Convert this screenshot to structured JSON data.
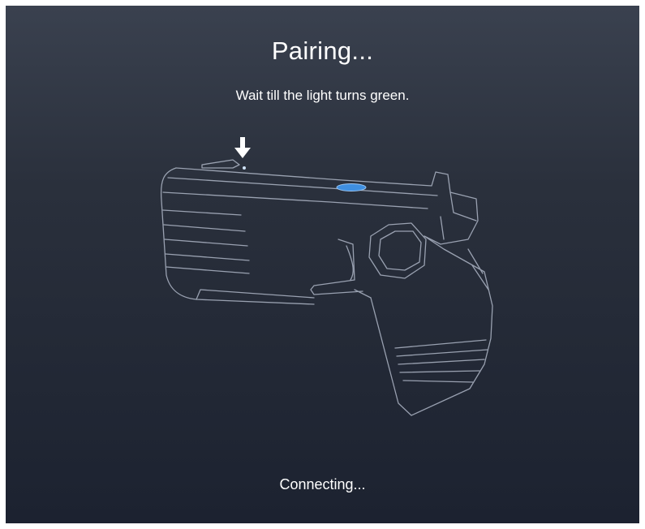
{
  "screen": {
    "title": "Pairing...",
    "instruction": "Wait till the light turns green.",
    "status": "Connecting..."
  },
  "illustration": {
    "icons": [
      "down-arrow-icon",
      "status-light-icon"
    ],
    "colors": {
      "background_top": "#3a414f",
      "background_bottom": "#1c2230",
      "outline": "#aeb6c6",
      "light": "#3f8fe0",
      "text": "#ffffff"
    }
  }
}
